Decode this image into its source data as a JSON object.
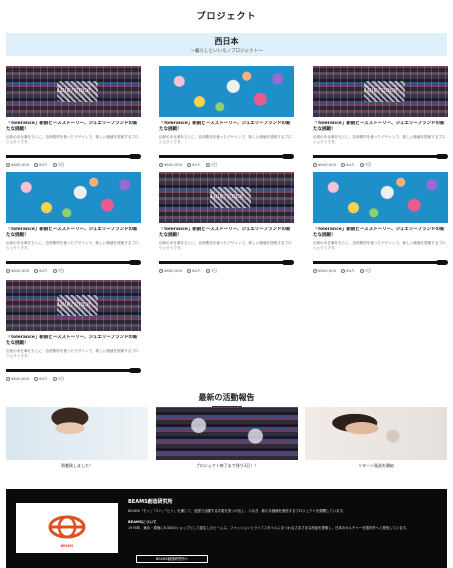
{
  "page": {
    "title": "プロジェクト"
  },
  "banner": {
    "title": "西日本",
    "subtitle": "〜暮らしといいモノプロジェクト〜"
  },
  "projects": [
    {
      "title": "「Tolerance」新鋭ビーズストーリー、ジュエリーブランドの新たな挑戦！",
      "desc": "伝統の手仕事をもとに、自然素材を使ったデザインで、新しい価値を提案するプロジェクトです。",
      "watermark": "Tolerance",
      "stats": [
        "¥840,000",
        "64人",
        "7日"
      ],
      "progress": 0.93,
      "image": "rug"
    },
    {
      "title": "「Tolerance」新鋭ビーズストーリー、ジュエリーブランドの新たな挑戦！",
      "desc": "伝統の手仕事をもとに、自然素材を使ったデザインで、新しい価値を提案するプロジェクトです。",
      "watermark": "",
      "stats": [
        "¥840,000",
        "64人",
        "7日"
      ],
      "progress": 0.93,
      "image": "flowers"
    },
    {
      "title": "「Tolerance」新鋭ビーズストーリー、ジュエリーブランドの新たな挑戦！",
      "desc": "伝統の手仕事をもとに、自然素材を使ったデザインで、新しい価値を提案するプロジェクトです。",
      "watermark": "Tolerance",
      "stats": [
        "¥840,000",
        "64人",
        "7日"
      ],
      "progress": 0.93,
      "image": "rug"
    },
    {
      "title": "「Tolerance」新鋭ビーズストーリー、ジュエリーブランドの新たな挑戦！",
      "desc": "伝統の手仕事をもとに、自然素材を使ったデザインで、新しい価値を提案するプロジェクトです。",
      "watermark": "",
      "stats": [
        "¥840,000",
        "64人",
        "7日"
      ],
      "progress": 0.93,
      "image": "flowers"
    },
    {
      "title": "「Tolerance」新鋭ビーズストーリー、ジュエリーブランドの新たな挑戦！",
      "desc": "伝統の手仕事をもとに、自然素材を使ったデザインで、新しい価値を提案するプロジェクトです。",
      "watermark": "Tolerance",
      "stats": [
        "¥840,000",
        "64人",
        "7日"
      ],
      "progress": 0.93,
      "image": "rug"
    },
    {
      "title": "「Tolerance」新鋭ビーズストーリー、ジュエリーブランドの新たな挑戦！",
      "desc": "伝統の手仕事をもとに、自然素材を使ったデザインで、新しい価値を提案するプロジェクトです。",
      "watermark": "",
      "stats": [
        "¥840,000",
        "64人",
        "7日"
      ],
      "progress": 0.93,
      "image": "flowers"
    },
    {
      "title": "「Tolerance」新鋭ビーズストーリー、ジュエリーブランドの新たな挑戦！",
      "desc": "伝統の手仕事をもとに、自然素材を使ったデザインで、新しい価値を提案するプロジェクトです。",
      "watermark": "Tolerance",
      "stats": [
        "¥840,000",
        "64人",
        "7日"
      ],
      "progress": 0.93,
      "image": "rug"
    }
  ],
  "reports": {
    "title": "最新の活動報告",
    "items": [
      {
        "caption": "到着致しました！",
        "image": "p1"
      },
      {
        "caption": "プロジェクト終了まで残り3日！！",
        "image": "p2"
      },
      {
        "caption": "リターン発送を開始",
        "image": "p3"
      }
    ]
  },
  "footer": {
    "title": "BEAMS創造研究所",
    "text": "BEAMS「モノ」「コト」「ヒト」を通じて、全国で活躍する才能を見つけ出し、つなぎ、新たな価値を発信するプロジェクトを展開しています。",
    "subtitle": "BEAMSについて",
    "text2": "1976年、東京・原宿に6.5坪のショップとして誕生したビームス。ファッションとライフスタイルにまつわるさまざまな商品を提案し、日本のカルチャーを国内外へと発信しています。",
    "button": "BEAMS創造研究所へ",
    "logo_text": "BEAMS"
  },
  "colors": {
    "banner_bg": "#dff0fa",
    "footer_bg": "#0a0a0a",
    "logo_orange": "#e0501e"
  }
}
